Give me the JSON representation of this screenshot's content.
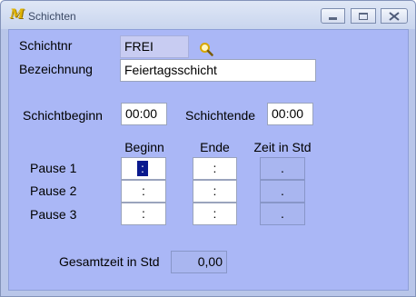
{
  "window": {
    "title": "Schichten",
    "app_icon_glyph": "M",
    "app_icon": "app-logo-icon"
  },
  "form": {
    "schichtnr_label": "Schichtnr",
    "schichtnr_value": "FREI",
    "bezeichnung_label": "Bezeichnung",
    "bezeichnung_value": "Feiertagsschicht",
    "schichtbeginn_label": "Schichtbeginn",
    "schichtbeginn_value": "00:00",
    "schichtende_label": "Schichtende",
    "schichtende_value": "00:00"
  },
  "pausen": {
    "headers": {
      "beginn": "Beginn",
      "ende": "Ende",
      "zeit": "Zeit in Std"
    },
    "rows": [
      {
        "label": "Pause 1",
        "beginn": ":",
        "ende": ":",
        "zeit": "."
      },
      {
        "label": "Pause 2",
        "beginn": ":",
        "ende": ":",
        "zeit": "."
      },
      {
        "label": "Pause 3",
        "beginn": ":",
        "ende": ":",
        "zeit": "."
      }
    ]
  },
  "summary": {
    "gesamtzeit_label": "Gesamtzeit in Std",
    "gesamtzeit_value": "0,00"
  },
  "colors": {
    "background": "#aab7f6",
    "caret": "#0a1a8e",
    "search_icon": "#d7a600"
  }
}
